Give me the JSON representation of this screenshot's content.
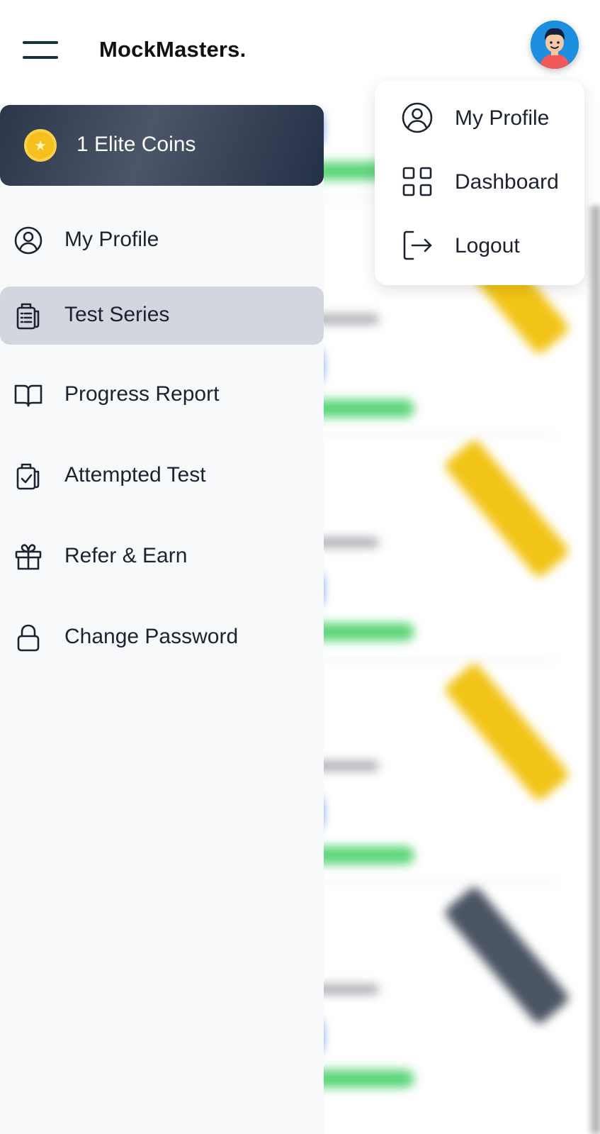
{
  "header": {
    "brand": "MockMasters.",
    "menu_icon": "hamburger-menu-icon",
    "avatar_icon": "user-avatar-icon"
  },
  "drawer": {
    "coins": {
      "text": "1 Elite Coins",
      "icon": "coin-star-icon"
    },
    "items": [
      {
        "label": "My Profile",
        "icon": "user-circle-icon",
        "active": false
      },
      {
        "label": "Test Series",
        "icon": "clipboard-list-icon",
        "active": true
      },
      {
        "label": "Progress Report",
        "icon": "open-book-icon",
        "active": false
      },
      {
        "label": "Attempted Test",
        "icon": "clipboard-check-icon",
        "active": false
      },
      {
        "label": "Refer & Earn",
        "icon": "gift-icon",
        "active": false
      },
      {
        "label": "Change Password",
        "icon": "lock-icon",
        "active": false
      }
    ]
  },
  "profile_menu": {
    "items": [
      {
        "label": "My Profile",
        "icon": "user-circle-icon"
      },
      {
        "label": "Dashboard",
        "icon": "grid-icon"
      },
      {
        "label": "Logout",
        "icon": "logout-icon"
      }
    ]
  },
  "colors": {
    "active_item_bg": "#d3d6df",
    "coin_card_bg": "#2b3649",
    "coin": "#f5bf1d",
    "brand_text": "#111111"
  }
}
